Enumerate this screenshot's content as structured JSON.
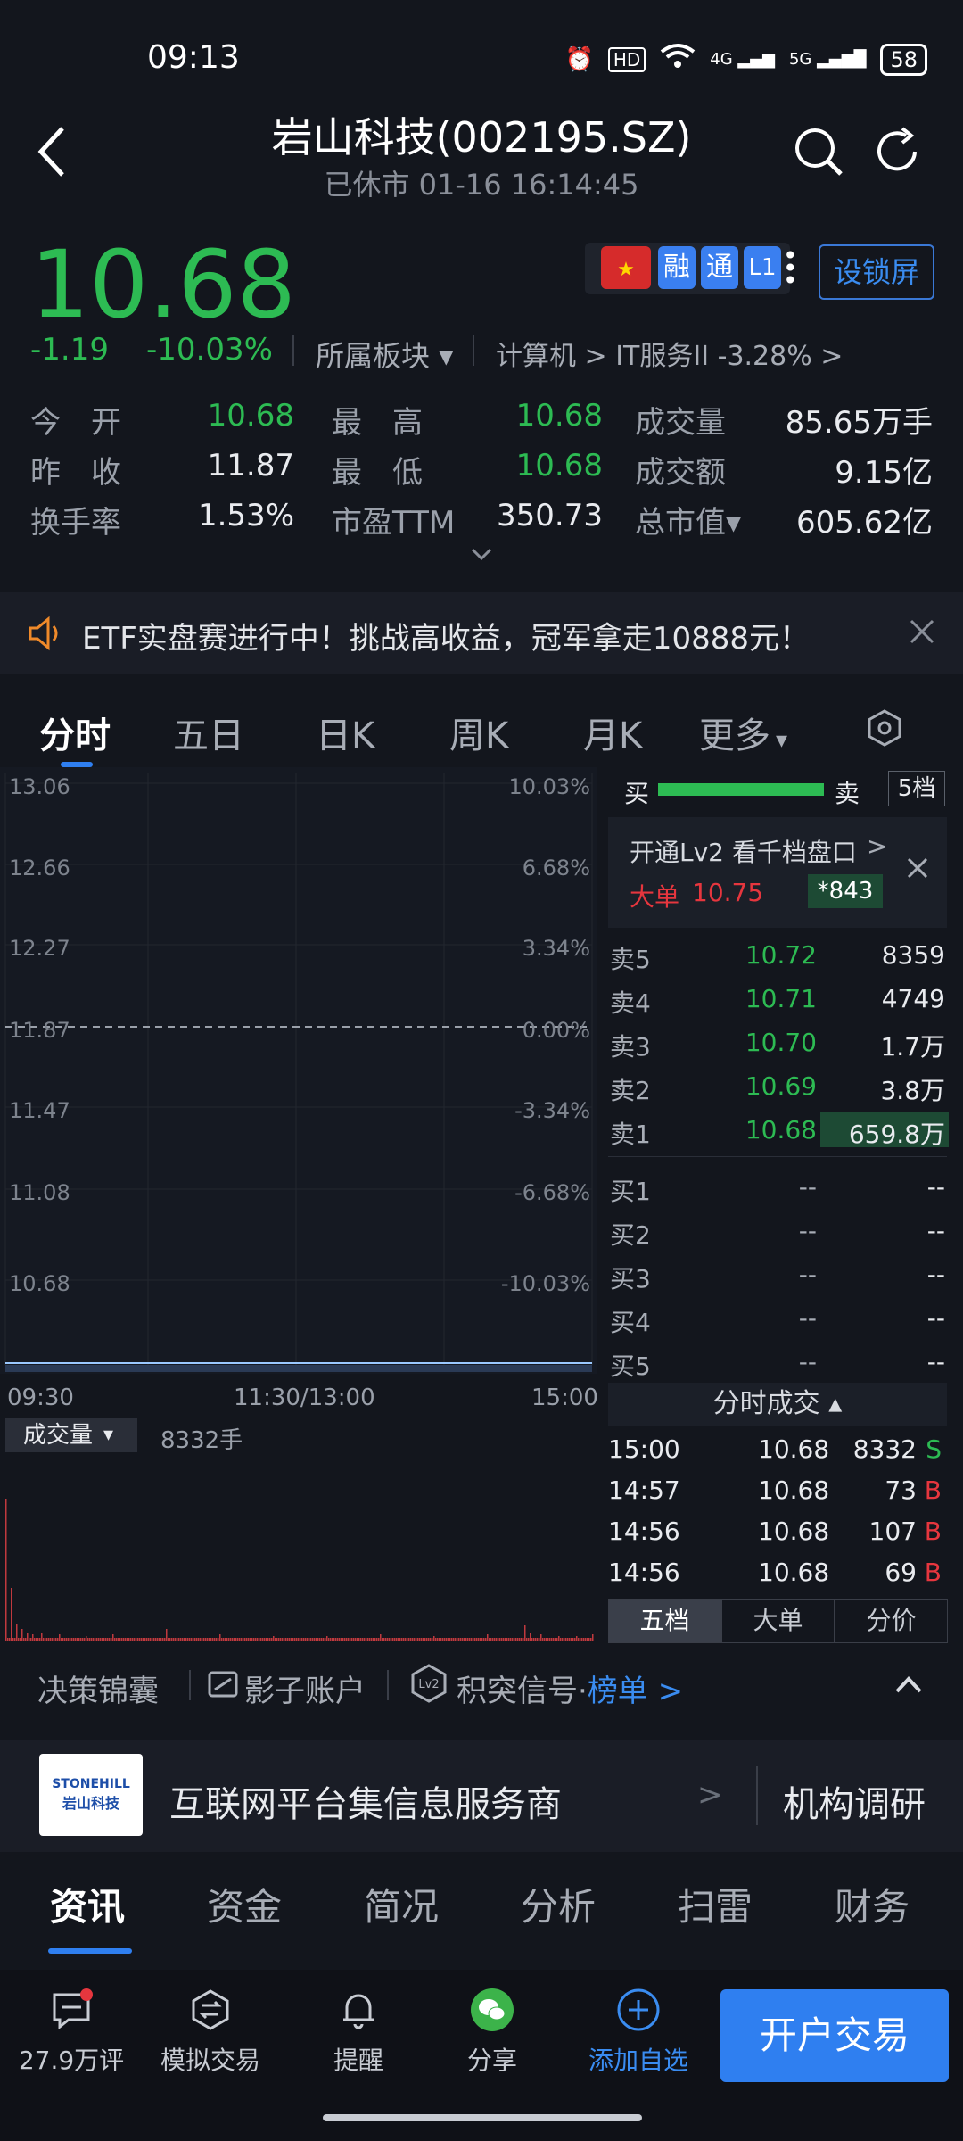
{
  "status_bar": {
    "time": "09:13",
    "battery": "58",
    "net1": "4G",
    "net2": "5G",
    "hd": "HD"
  },
  "header": {
    "title": "岩山科技(002195.SZ)",
    "subtitle": "已休市 01-16 16:14:45"
  },
  "quote": {
    "price": "10.68",
    "change": "-1.19",
    "change_pct": "-10.03%",
    "sector_label": "所属板块",
    "sector_path": "计算机 >  IT服务II -3.28% >"
  },
  "badges": {
    "rong": "融",
    "tong": "通",
    "l1": "L1",
    "lock_button": "设锁屏"
  },
  "stats": [
    {
      "label": "今　开",
      "value": "10.68",
      "color": "green"
    },
    {
      "label": "最　高",
      "value": "10.68",
      "color": "green"
    },
    {
      "label": "成交量",
      "value": "85.65万手",
      "color": "white"
    },
    {
      "label": "昨　收",
      "value": "11.87",
      "color": "white"
    },
    {
      "label": "最　低",
      "value": "10.68",
      "color": "green"
    },
    {
      "label": "成交额",
      "value": "9.15亿",
      "color": "white"
    },
    {
      "label": "换手率",
      "value": "1.53%",
      "color": "white"
    },
    {
      "label": "市盈TTM",
      "value": "350.73",
      "color": "white"
    },
    {
      "label": "总市值▾",
      "value": "605.62亿",
      "color": "white"
    }
  ],
  "banner": {
    "text": "ETF实盘赛进行中！挑战高收益，冠军拿走10888元！"
  },
  "chart_tabs": [
    "分时",
    "五日",
    "日K",
    "周K",
    "月K",
    "更多"
  ],
  "chart": {
    "y_left": [
      "13.06",
      "12.66",
      "12.27",
      "11.87",
      "11.47",
      "11.08",
      "10.68"
    ],
    "y_right": [
      "10.03%",
      "6.68%",
      "3.34%",
      "0.00%",
      "-3.34%",
      "-6.68%",
      "-10.03%"
    ],
    "x_labels": [
      "09:30",
      "11:30/13:00",
      "15:00"
    ],
    "volume_label": "成交量",
    "volume_value": "8332手"
  },
  "orderbook": {
    "buy_label": "买",
    "sell_label": "卖",
    "levels_btn": "5档",
    "lv2_text": "开通Lv2 看千档盘口",
    "big_label": "大单",
    "big_price": "10.75",
    "big_vol": "*843",
    "asks": [
      {
        "name": "卖5",
        "price": "10.72",
        "vol": "8359"
      },
      {
        "name": "卖4",
        "price": "10.71",
        "vol": "4749"
      },
      {
        "name": "卖3",
        "price": "10.70",
        "vol": "1.7万"
      },
      {
        "name": "卖2",
        "price": "10.69",
        "vol": "3.8万"
      },
      {
        "name": "卖1",
        "price": "10.68",
        "vol": "659.8万"
      }
    ],
    "bids": [
      {
        "name": "买1",
        "price": "--",
        "vol": "--"
      },
      {
        "name": "买2",
        "price": "--",
        "vol": "--"
      },
      {
        "name": "买3",
        "price": "--",
        "vol": "--"
      },
      {
        "name": "买4",
        "price": "--",
        "vol": "--"
      },
      {
        "name": "买5",
        "price": "--",
        "vol": "--"
      }
    ],
    "ticks_title": "分时成交",
    "ticks": [
      {
        "t": "15:00",
        "p": "10.68",
        "v": "8332",
        "s": "S"
      },
      {
        "t": "14:57",
        "p": "10.68",
        "v": "73",
        "s": "B"
      },
      {
        "t": "14:56",
        "p": "10.68",
        "v": "107",
        "s": "B"
      },
      {
        "t": "14:56",
        "p": "10.68",
        "v": "69",
        "s": "B"
      }
    ],
    "bottom_tabs": [
      "五档",
      "大单",
      "分价"
    ]
  },
  "tools": {
    "t1": "决策锦囊",
    "t2": "影子账户",
    "t3": "积突信号·",
    "t3_link": "榜单 >"
  },
  "company": {
    "logo_line1": "STONEHILL",
    "logo_line2": "岩山科技",
    "desc": "互联网平台集信息服务商",
    "research": "机构调研"
  },
  "info_tabs": [
    "资讯",
    "资金",
    "简况",
    "分析",
    "扫雷",
    "财务"
  ],
  "bottom_nav": {
    "comments": "27.9万评",
    "sim": "模拟交易",
    "remind": "提醒",
    "share": "分享",
    "add": "添加自选",
    "trade": "开户交易"
  },
  "colors": {
    "up": "#e6363e",
    "down": "#2dbb53",
    "accent": "#2f7ff0",
    "bg": "#13161d"
  }
}
